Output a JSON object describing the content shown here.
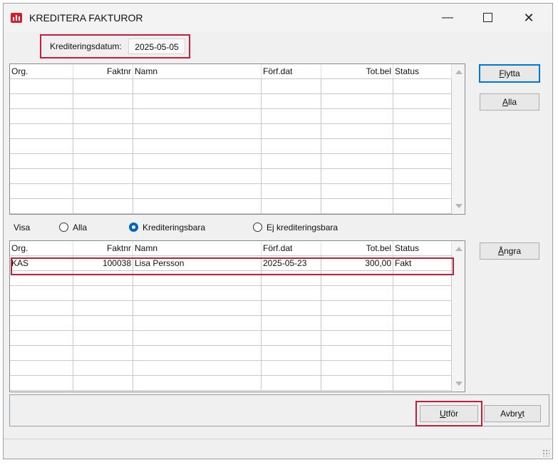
{
  "window": {
    "title": "KREDITERA FAKTUROR",
    "controls": {
      "minimize": "—",
      "close": "✕"
    }
  },
  "date_field": {
    "label": "Krediteringsdatum:",
    "value": "2025-05-05"
  },
  "grid_columns": [
    "Org.",
    "Faktnr",
    "Namn",
    "Förf.dat",
    "Tot.bel",
    "Status"
  ],
  "top_grid": {
    "rows": []
  },
  "visa": {
    "label": "Visa",
    "options": [
      {
        "label": "Alla",
        "selected": false
      },
      {
        "label": "Krediteringsbara",
        "selected": true
      },
      {
        "label": "Ej krediteringsbara",
        "selected": false
      }
    ]
  },
  "bottom_grid": {
    "rows": [
      {
        "org": "KAS",
        "faktnr": "100038",
        "namn": "Lisa Persson",
        "forfdat": "2025-05-23",
        "totbel": "300,00",
        "status": "Fakt"
      }
    ]
  },
  "buttons": {
    "flytta": {
      "pre": "",
      "ul": "F",
      "post": "lytta"
    },
    "alla": {
      "pre": "",
      "ul": "A",
      "post": "lla"
    },
    "angra": {
      "pre": "",
      "ul": "Å",
      "post": "ngra"
    },
    "utfor": {
      "pre": "",
      "ul": "U",
      "post": "tför"
    },
    "avbryt": {
      "pre": "Avbr",
      "ul": "y",
      "post": "t"
    }
  },
  "colors": {
    "highlight": "#c61f3b",
    "accent": "#0067c0",
    "app_icon": "#d21f2a"
  },
  "icons": [
    "app-logo-icon",
    "minimize-icon",
    "maximize-icon",
    "close-icon",
    "scroll-up-icon",
    "scroll-down-icon",
    "resize-grip-icon"
  ]
}
